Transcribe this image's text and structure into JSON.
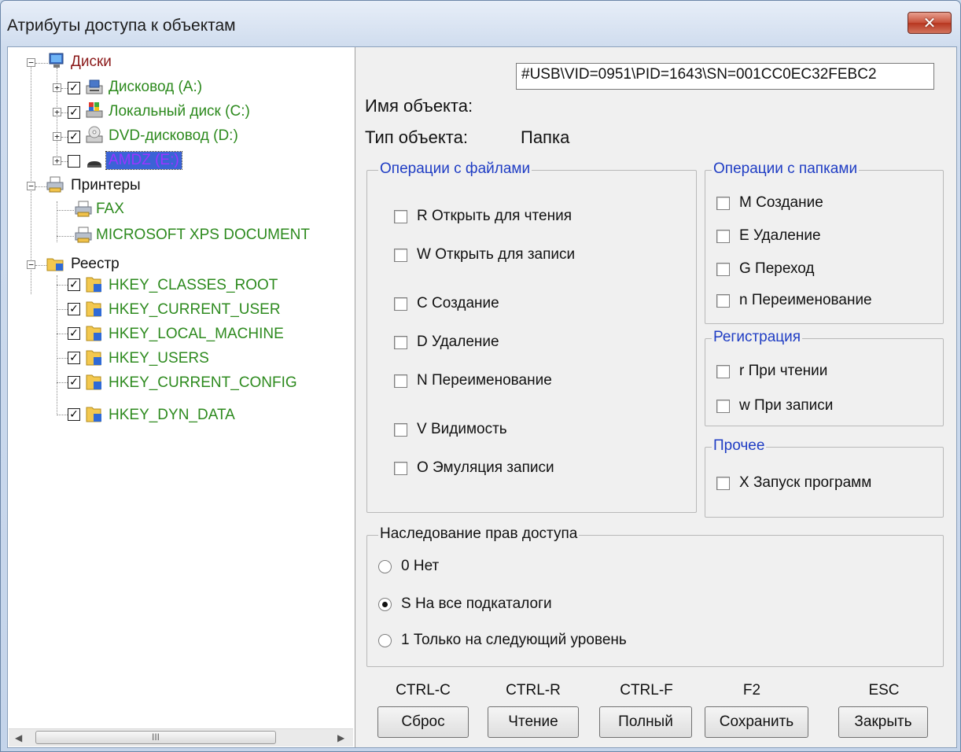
{
  "window": {
    "title": "Атрибуты доступа к объектам",
    "close_glyph": "✕"
  },
  "tree": {
    "disks": {
      "label": "Диски",
      "items": [
        {
          "label": "Дисковод (A:)",
          "checked": true,
          "icon": "floppy-drive-icon"
        },
        {
          "label": "Локальный диск (C:)",
          "checked": true,
          "icon": "local-disk-icon"
        },
        {
          "label": "DVD-дисковод (D:)",
          "checked": true,
          "icon": "dvd-drive-icon"
        },
        {
          "label": "AMDZ (E:)",
          "checked": false,
          "icon": "removable-drive-icon",
          "selected": true
        }
      ]
    },
    "printers": {
      "label": "Принтеры",
      "items": [
        "FAX",
        "MICROSOFT XPS DOCUMENT"
      ]
    },
    "registry": {
      "label": "Реестр",
      "items": [
        "HKEY_CLASSES_ROOT",
        "HKEY_CURRENT_USER",
        "HKEY_LOCAL_MACHINE",
        "HKEY_USERS",
        "HKEY_CURRENT_CONFIG",
        "HKEY_DYN_DATA"
      ]
    },
    "scroll_left": "◀",
    "scroll_right": "▶",
    "scroll_grip": "III"
  },
  "object": {
    "name_label": "Имя объекта:",
    "name_value": "#USB\\VID=0951\\PID=1643\\SN=001CC0EC32FEBC2",
    "type_label": "Тип объекта:",
    "type_value": "Папка"
  },
  "file_ops": {
    "title": "Операции с файлами",
    "items": [
      "R Открыть для чтения",
      "W Открыть для записи",
      "C Создание",
      "D Удаление",
      "N Переименование",
      "V Видимость",
      "O Эмуляция записи"
    ]
  },
  "folder_ops": {
    "title": "Операции с папками",
    "items": [
      "M Создание",
      "E Удаление",
      "G Переход",
      "n Переименование"
    ]
  },
  "registration": {
    "title": "Регистрация",
    "items": [
      "r При чтении",
      "w При записи"
    ]
  },
  "other": {
    "title": "Прочее",
    "items": [
      "X Запуск программ"
    ]
  },
  "inheritance": {
    "title": "Наследование прав доступа",
    "options": [
      "0 Нет",
      "S На все подкаталоги",
      "1 Только на следующий уровень"
    ],
    "selected_index": 1
  },
  "buttons": [
    {
      "hotkey": "CTRL-C",
      "label": "Сброс"
    },
    {
      "hotkey": "CTRL-R",
      "label": "Чтение"
    },
    {
      "hotkey": "CTRL-F",
      "label": "Полный"
    },
    {
      "hotkey": "F2",
      "label": "Сохранить"
    },
    {
      "hotkey": "ESC",
      "label": "Закрыть"
    }
  ]
}
